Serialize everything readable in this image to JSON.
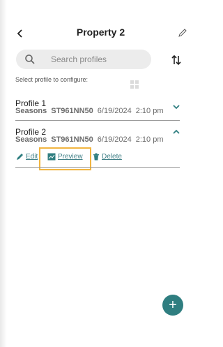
{
  "header": {
    "title": "Property 2"
  },
  "search": {
    "placeholder": "Search profiles"
  },
  "instructions": "Select profile to configure:",
  "profiles": [
    {
      "name": "Profile 1",
      "season": "Seasons",
      "code": "ST961NN50",
      "date": "6/19/2024",
      "time": "2:10 pm",
      "expanded": false
    },
    {
      "name": "Profile 2",
      "season": "Seasons",
      "code": "ST961NN50",
      "date": "6/19/2024",
      "time": "2:10 pm",
      "expanded": true
    }
  ],
  "actions": {
    "edit": "Edit",
    "preview": "Preview",
    "delete": "Delete"
  },
  "colors": {
    "accent": "#3f7f86",
    "fab": "#2f7e80",
    "highlight": "#f1b541"
  },
  "icons": {
    "back": "chevron-left-icon",
    "rename": "pencil-icon",
    "search": "search-icon",
    "sort": "sort-arrows-icon",
    "expand": "chevron-down-icon",
    "collapse": "chevron-up-icon",
    "edit": "pencil-icon",
    "preview": "preview-icon",
    "delete": "trash-icon",
    "add": "plus-icon"
  }
}
